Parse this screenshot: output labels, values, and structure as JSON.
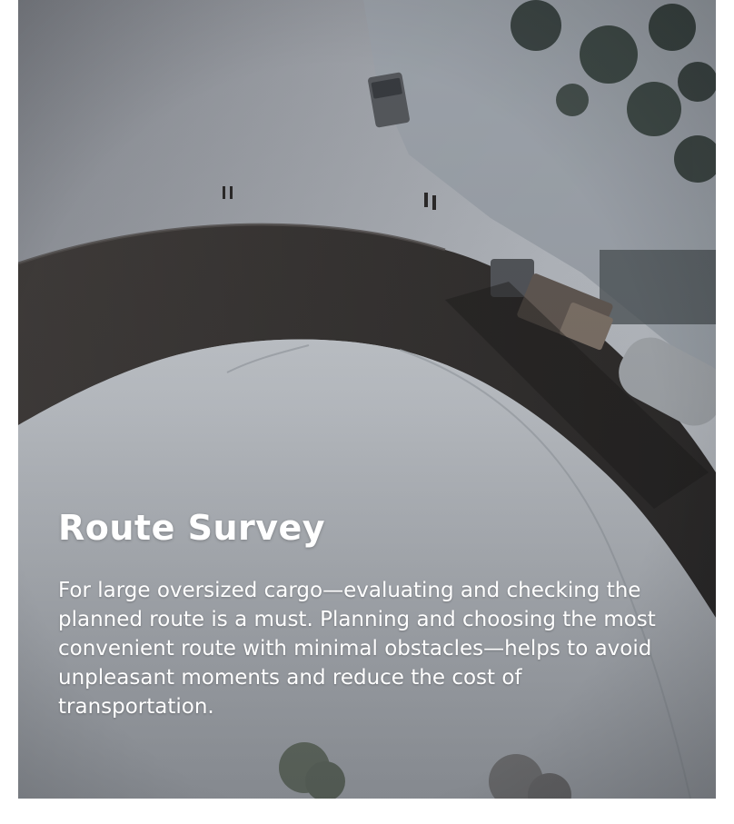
{
  "card": {
    "title": "Route Survey",
    "description": "For large oversized cargo—evaluating and checking the planned route is a must. Planning and choosing the most convenient route with minimal obstacles—helps to avoid unpleasant moments and reduce the cost of transportation."
  },
  "colors": {
    "text": "#ffffff",
    "overlay": "#14181e",
    "snow": "#d7dbe1",
    "road": "#3f3a37"
  },
  "icons": {
    "background": "aerial-winter-road-photo"
  }
}
